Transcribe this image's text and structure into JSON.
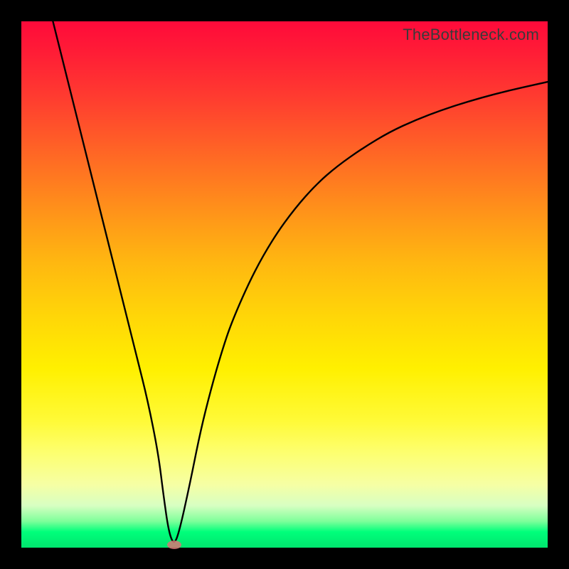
{
  "watermark": "TheBottleneck.com",
  "chart_data": {
    "type": "line",
    "title": "",
    "xlabel": "",
    "ylabel": "",
    "xlim": [
      0,
      100
    ],
    "ylim": [
      0,
      100
    ],
    "grid": false,
    "series": [
      {
        "name": "bottleneck-curve",
        "x": [
          6,
          8,
          10,
          12,
          14,
          16,
          18,
          20,
          22,
          24,
          26,
          27,
          28,
          29,
          30,
          32,
          34,
          36,
          38,
          40,
          44,
          48,
          52,
          56,
          60,
          65,
          70,
          75,
          80,
          85,
          90,
          95,
          100
        ],
        "y": [
          100,
          92,
          84,
          76,
          68,
          60,
          52,
          44,
          36,
          28,
          18,
          10,
          3,
          0.5,
          3,
          12,
          22,
          30,
          37,
          43,
          52,
          59,
          64.5,
          69,
          72.5,
          76,
          79,
          81.3,
          83.2,
          84.8,
          86.2,
          87.4,
          88.5
        ]
      }
    ],
    "annotations": [
      {
        "name": "minimum-marker",
        "x": 29,
        "y": 0.5
      }
    ],
    "colors": {
      "curve": "#000000",
      "top": "#ff0a3a",
      "bottom": "#00e56e",
      "marker": "#d87676"
    }
  }
}
